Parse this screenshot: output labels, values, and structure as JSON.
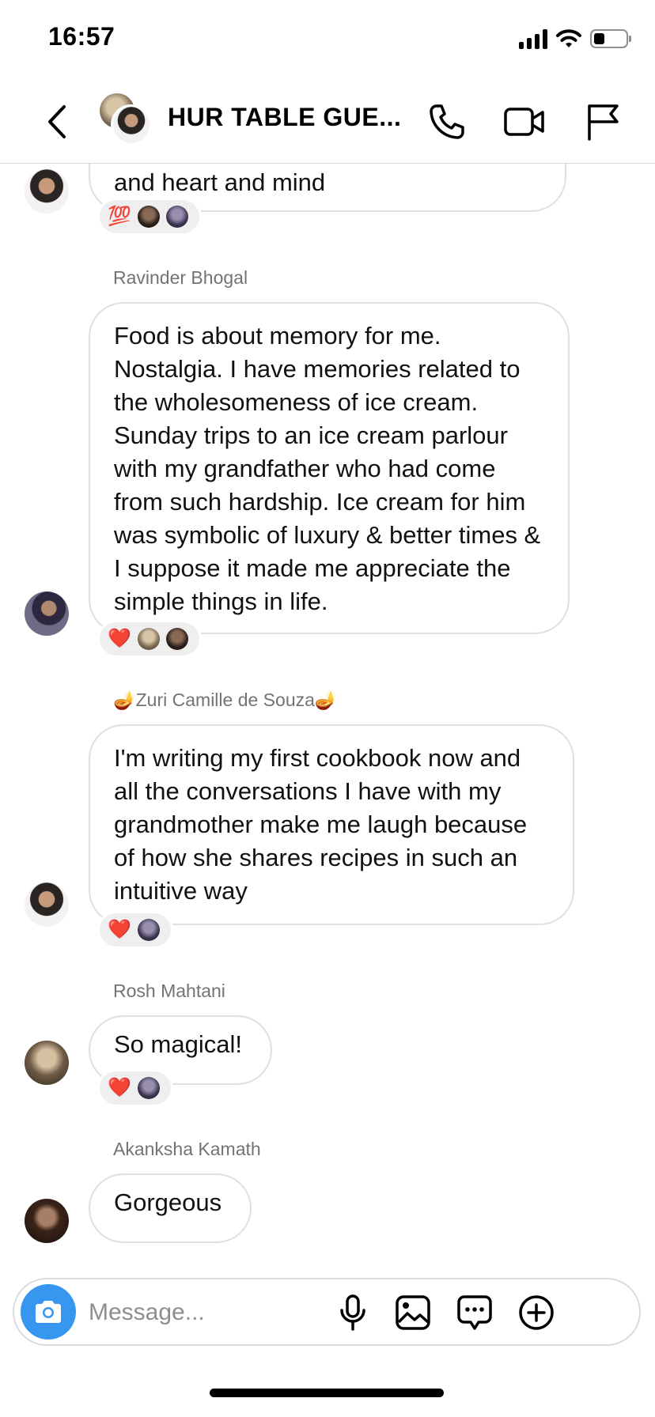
{
  "status_bar": {
    "time": "16:57"
  },
  "header": {
    "title": "HUR TABLE GUE...",
    "icons": [
      "back-chevron-icon",
      "phone-icon",
      "video-camera-icon",
      "flag-icon"
    ]
  },
  "messages": [
    {
      "sender": "",
      "text": "and heart and mind",
      "reactions": [
        "💯"
      ]
    },
    {
      "sender": "Ravinder Bhogal",
      "text": "Food is about memory for me. Nostalgia. I have memories related to the wholesomeness of ice cream. Sunday trips to an ice cream parlour with my grandfather who had come from such hardship. Ice cream for him was symbolic of luxury & better times & I suppose it made me appreciate the simple things in life.",
      "reactions": [
        "❤️"
      ]
    },
    {
      "sender": "🪔Zuri Camille de Souza🪔",
      "text": "I'm writing my first cookbook now and all the conversations I have with my grandmother make me laugh because of how she shares recipes in such an intuitive way",
      "reactions": [
        "❤️"
      ]
    },
    {
      "sender": "Rosh Mahtani",
      "text": "So magical!",
      "reactions": [
        "❤️"
      ]
    },
    {
      "sender": "Akanksha Kamath",
      "text": "Gorgeous",
      "reactions": []
    }
  ],
  "composer": {
    "placeholder": "Message...",
    "icons": [
      "camera-icon",
      "microphone-icon",
      "gallery-icon",
      "sticker-chat-icon",
      "add-icon"
    ]
  },
  "colors": {
    "accent": "#3797f0",
    "reaction_heart": "#e0245e",
    "bubble_border": "#e0e0e0",
    "sender_label": "#737373"
  }
}
